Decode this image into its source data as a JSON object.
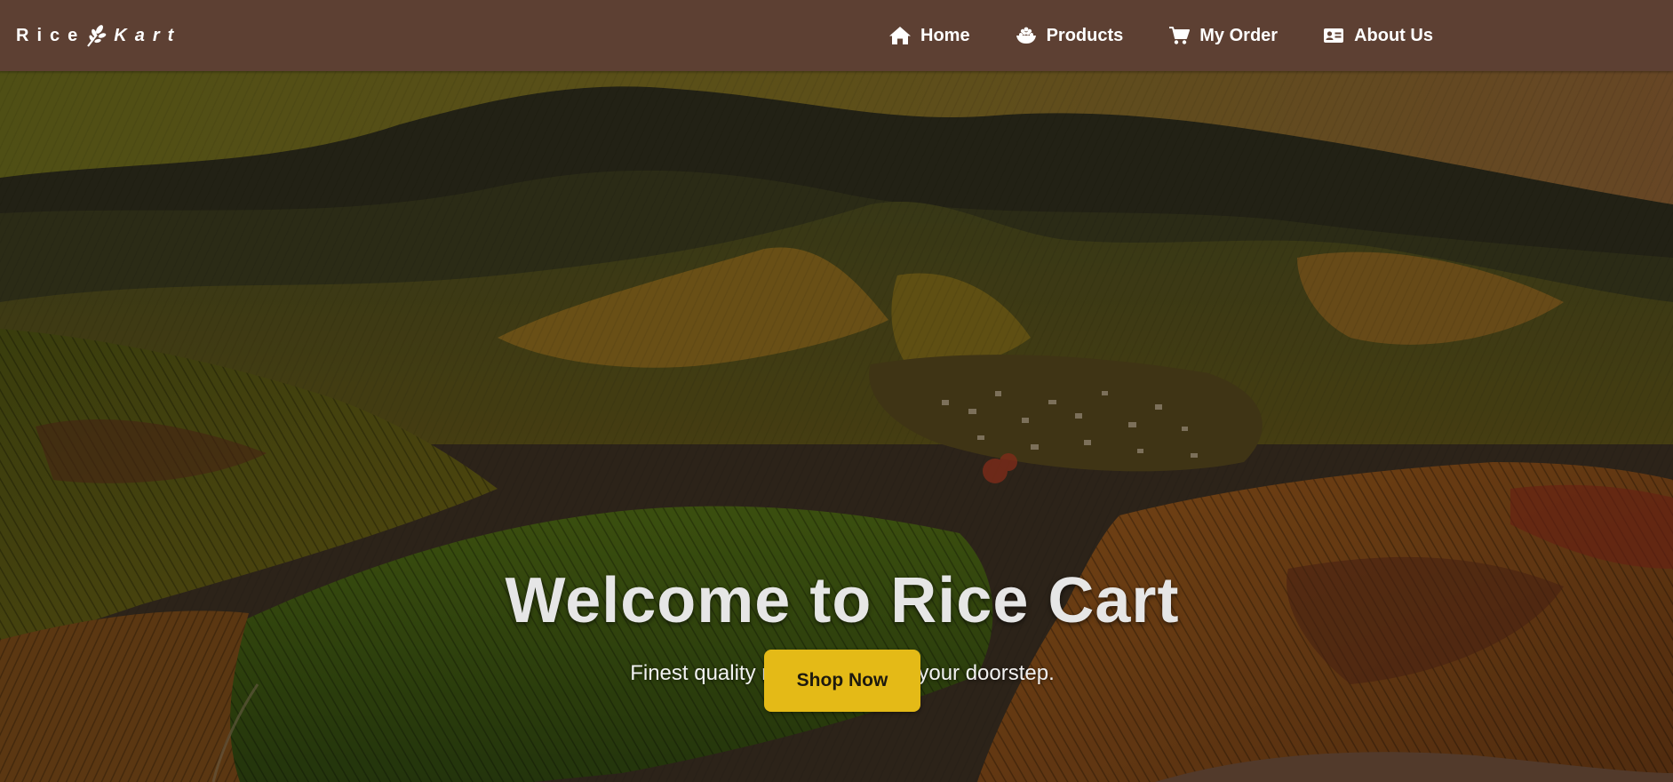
{
  "brand": {
    "part1": "Rice",
    "part2": "Kart",
    "icon": "wheat-leaf-icon"
  },
  "nav": {
    "items": [
      {
        "label": "Home",
        "icon": "home-icon"
      },
      {
        "label": "Products",
        "icon": "rice-bowl-icon"
      },
      {
        "label": "My Order",
        "icon": "cart-icon"
      },
      {
        "label": "About Us",
        "icon": "id-card-icon"
      }
    ]
  },
  "hero": {
    "title": "Welcome to Rice Cart",
    "subtitle": "Finest quality rice delivered to your doorstep.",
    "cta_label": "Shop Now"
  },
  "colors": {
    "navbar": "#5d4033",
    "accent": "#e4ba17",
    "text_light": "#e6e6e6"
  }
}
